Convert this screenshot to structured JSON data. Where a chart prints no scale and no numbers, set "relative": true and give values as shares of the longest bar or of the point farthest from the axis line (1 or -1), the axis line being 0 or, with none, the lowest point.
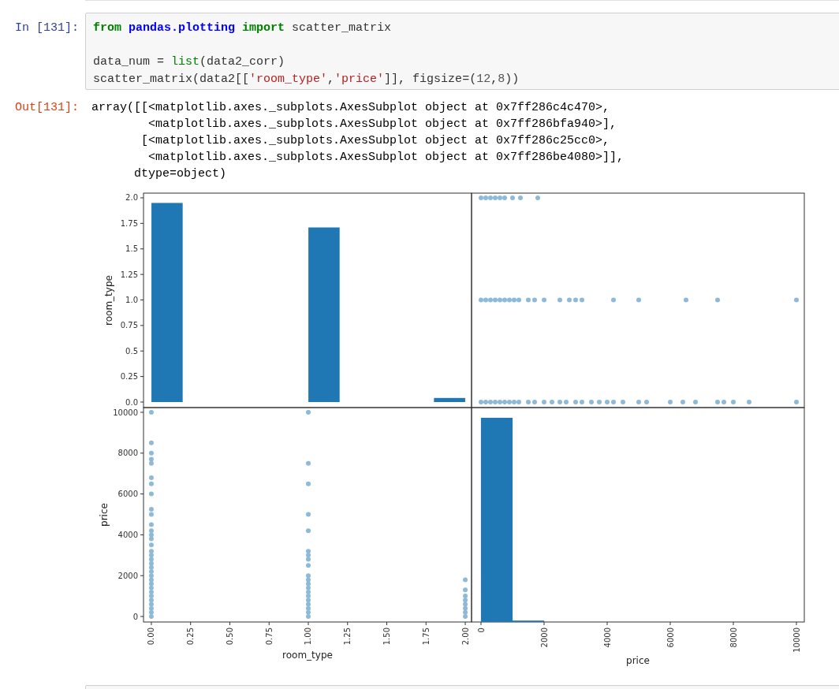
{
  "input_cell": {
    "prompt": "In [131]:",
    "code_blocks": [
      [
        [
          {
            "kind": "keyword",
            "text": "from"
          },
          {
            "kind": "module",
            "text": " pandas.plotting "
          },
          {
            "kind": "keyword",
            "text": "import"
          },
          {
            "kind": "plain",
            "text": " scatter_matrix"
          }
        ]
      ],
      [
        [
          {
            "kind": "plain",
            "text": "data_num = "
          },
          {
            "kind": "builtin",
            "text": "list"
          },
          {
            "kind": "plain",
            "text": "(data2_corr)"
          }
        ],
        [
          {
            "kind": "plain",
            "text": "scatter_matrix(data2[["
          },
          {
            "kind": "string",
            "text": "'room_type'"
          },
          {
            "kind": "plain",
            "text": ","
          },
          {
            "kind": "string",
            "text": "'price'"
          },
          {
            "kind": "plain",
            "text": "]], figsize=("
          },
          {
            "kind": "number",
            "text": "12"
          },
          {
            "kind": "plain",
            "text": ","
          },
          {
            "kind": "number",
            "text": "8"
          },
          {
            "kind": "plain",
            "text": "))"
          }
        ]
      ]
    ]
  },
  "output_cell": {
    "prompt": "Out[131]:",
    "lines": [
      "array([[<matplotlib.axes._subplots.AxesSubplot object at 0x7ff286c4c470>,",
      "        <matplotlib.axes._subplots.AxesSubplot object at 0x7ff286bfa940>],",
      "       [<matplotlib.axes._subplots.AxesSubplot object at 0x7ff286c25cc0>,",
      "        <matplotlib.axes._subplots.AxesSubplot object at 0x7ff286be4080>]],",
      "      dtype=object)"
    ],
    "panels": [
      {
        "chart_data": {
          "type": "bar",
          "ylabel": "room_type",
          "xlim": [
            -0.05,
            2.04
          ],
          "ylim": [
            -0.054,
            2.046
          ],
          "yticks": [
            {
              "value": 0,
              "label": "0.0"
            },
            {
              "value": 0.25,
              "label": "0.25"
            },
            {
              "value": 0.5,
              "label": "0.5"
            },
            {
              "value": 0.75,
              "label": "0.75"
            },
            {
              "value": 1,
              "label": "1.0"
            },
            {
              "value": 1.25,
              "label": "1.25"
            },
            {
              "value": 1.5,
              "label": "1.5"
            },
            {
              "value": 1.75,
              "label": "1.75"
            },
            {
              "value": 2,
              "label": "2.0"
            }
          ],
          "x": [
            0.1,
            1.1,
            1.9
          ],
          "series": [
            {
              "color": "#1f77b4",
              "values": [
                1.95,
                1.71,
                0.04
              ]
            }
          ]
        }
      },
      {
        "chart_data": {
          "type": "scatter",
          "xlim": [
            -300,
            10250
          ],
          "ylim": [
            -0.054,
            2.046
          ],
          "x": [
            0,
            150,
            300,
            450,
            600,
            750,
            1000,
            1250,
            1800,
            0,
            150,
            300,
            450,
            600,
            750,
            900,
            1050,
            1200,
            1500,
            1700,
            2000,
            2500,
            2800,
            3000,
            3200,
            4200,
            5000,
            6500,
            7500,
            10000,
            0,
            150,
            300,
            450,
            600,
            750,
            900,
            1050,
            1200,
            1500,
            1700,
            2000,
            2250,
            2500,
            2700,
            3000,
            3200,
            3500,
            3750,
            4000,
            4200,
            4500,
            5000,
            5250,
            6000,
            6400,
            6800,
            7500,
            7700,
            8000,
            8500,
            10000
          ],
          "series": [
            {
              "color": "#8ebad9",
              "values": [
                2,
                2,
                2,
                2,
                2,
                2,
                2,
                2,
                2,
                1,
                1,
                1,
                1,
                1,
                1,
                1,
                1,
                1,
                1,
                1,
                1,
                1,
                1,
                1,
                1,
                1,
                1,
                1,
                1,
                1,
                0,
                0,
                0,
                0,
                0,
                0,
                0,
                0,
                0,
                0,
                0,
                0,
                0,
                0,
                0,
                0,
                0,
                0,
                0,
                0,
                0,
                0,
                0,
                0,
                0,
                0,
                0,
                0,
                0,
                0,
                0,
                0
              ]
            }
          ]
        }
      },
      {
        "chart_data": {
          "type": "scatter",
          "xlabel": "room_type",
          "ylabel": "price",
          "xlim": [
            -0.05,
            2.04
          ],
          "ylim": [
            -270,
            10232
          ],
          "xticks": [
            {
              "value": 0,
              "label": "0.00"
            },
            {
              "value": 0.25,
              "label": "0.25"
            },
            {
              "value": 0.5,
              "label": "0.50"
            },
            {
              "value": 0.75,
              "label": "0.75"
            },
            {
              "value": 1,
              "label": "1.00"
            },
            {
              "value": 1.25,
              "label": "1.25"
            },
            {
              "value": 1.5,
              "label": "1.50"
            },
            {
              "value": 1.75,
              "label": "1.75"
            },
            {
              "value": 2,
              "label": "2.00"
            }
          ],
          "yticks": [
            {
              "value": 0,
              "label": "0"
            },
            {
              "value": 2000,
              "label": "2000"
            },
            {
              "value": 4000,
              "label": "4000"
            },
            {
              "value": 6000,
              "label": "6000"
            },
            {
              "value": 8000,
              "label": "8000"
            },
            {
              "value": 10000,
              "label": "10000"
            }
          ],
          "x": [
            0,
            0,
            0,
            0,
            0,
            0,
            0,
            0,
            0,
            0,
            0,
            0,
            0,
            0,
            0,
            0,
            0,
            0,
            0,
            0,
            0,
            0,
            0,
            0,
            0,
            0,
            0,
            0,
            0,
            0,
            0,
            0,
            1,
            1,
            1,
            1,
            1,
            1,
            1,
            1,
            1,
            1,
            1,
            1,
            1,
            1,
            1,
            1,
            1,
            1,
            1,
            1,
            2,
            2,
            2,
            2,
            2,
            2,
            2,
            2
          ],
          "series": [
            {
              "color": "#8ebad9",
              "values": [
                10000,
                8500,
                8000,
                7700,
                7500,
                6800,
                6500,
                6000,
                5250,
                5000,
                4500,
                4200,
                4000,
                3800,
                3500,
                3200,
                3000,
                2800,
                2600,
                2400,
                2200,
                2000,
                1800,
                1600,
                1400,
                1200,
                1000,
                800,
                600,
                400,
                200,
                0,
                10000,
                7500,
                6500,
                5000,
                4200,
                3200,
                3000,
                2800,
                2500,
                2000,
                1800,
                1600,
                1400,
                1200,
                1000,
                800,
                600,
                400,
                200,
                0,
                1800,
                1300,
                1000,
                800,
                600,
                400,
                200,
                0
              ]
            }
          ]
        }
      },
      {
        "chart_data": {
          "type": "bar",
          "relative": true,
          "xlabel": "price",
          "xlim": [
            -300,
            10250
          ],
          "xticks": [
            {
              "value": 0,
              "label": "0"
            },
            {
              "value": 2000,
              "label": "2000"
            },
            {
              "value": 4000,
              "label": "4000"
            },
            {
              "value": 6000,
              "label": "6000"
            },
            {
              "value": 8000,
              "label": "8000"
            },
            {
              "value": 10000,
              "label": "10000"
            }
          ],
          "x": [
            500,
            1500
          ],
          "series": [
            {
              "color": "#1f77b4",
              "values": [
                1,
                0.007
              ]
            }
          ]
        }
      }
    ]
  }
}
